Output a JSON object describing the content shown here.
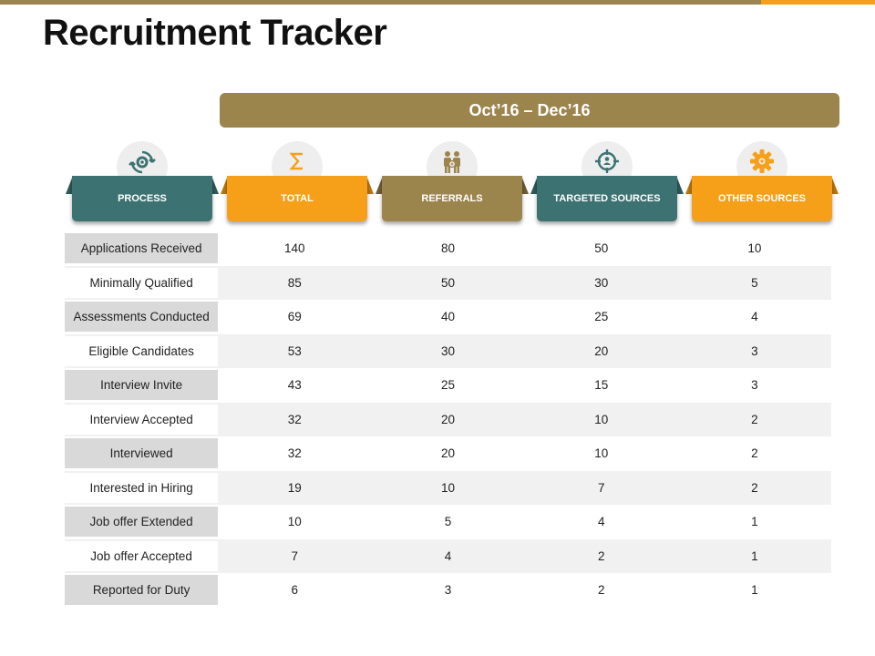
{
  "title": "Recruitment Tracker",
  "period": "Oct’16 – Dec’16",
  "columns": [
    {
      "label": "PROCESS",
      "icon": "refresh-gear-icon",
      "color": "#3d7272"
    },
    {
      "label": "TOTAL",
      "icon": "sigma-icon",
      "color": "#f6a01a"
    },
    {
      "label": "REFERRALS",
      "icon": "people-icon",
      "color": "#9c844d"
    },
    {
      "label": "TARGETED  SOURCES",
      "icon": "target-person-icon",
      "color": "#3d7272"
    },
    {
      "label": "OTHER SOURCES",
      "icon": "gear-icon",
      "color": "#f6a01a"
    }
  ],
  "rows": [
    {
      "label": "Applications Received",
      "values": [
        "140",
        "80",
        "50",
        "10"
      ]
    },
    {
      "label": "Minimally Qualified",
      "values": [
        "85",
        "50",
        "30",
        "5"
      ]
    },
    {
      "label": "Assessments Conducted",
      "values": [
        "69",
        "40",
        "25",
        "4"
      ]
    },
    {
      "label": "Eligible Candidates",
      "values": [
        "53",
        "30",
        "20",
        "3"
      ]
    },
    {
      "label": "Interview Invite",
      "values": [
        "43",
        "25",
        "15",
        "3"
      ]
    },
    {
      "label": "Interview Accepted",
      "values": [
        "32",
        "20",
        "10",
        "2"
      ]
    },
    {
      "label": "Interviewed",
      "values": [
        "32",
        "20",
        "10",
        "2"
      ]
    },
    {
      "label": "Interested in Hiring",
      "values": [
        "19",
        "10",
        "7",
        "2"
      ]
    },
    {
      "label": "Job offer Extended",
      "values": [
        "10",
        "5",
        "4",
        "1"
      ]
    },
    {
      "label": "Job offer Accepted",
      "values": [
        "7",
        "4",
        "2",
        "1"
      ]
    },
    {
      "label": "Reported for Duty",
      "values": [
        "6",
        "3",
        "2",
        "1"
      ]
    }
  ]
}
